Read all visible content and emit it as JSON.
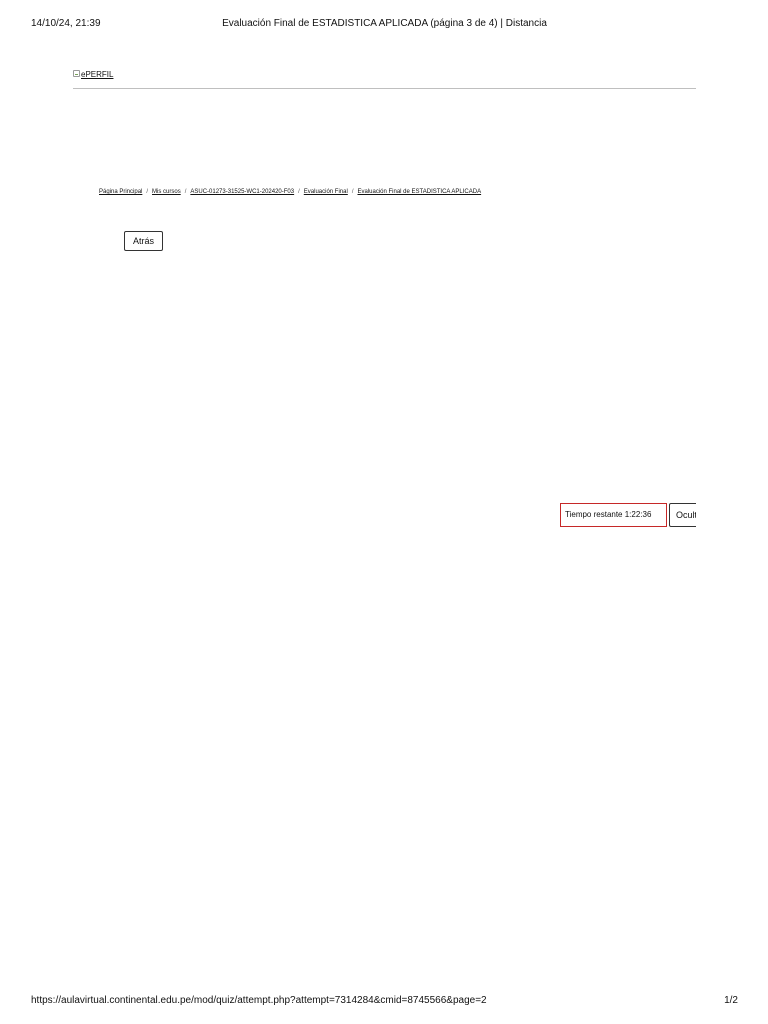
{
  "print_header": {
    "date": "14/10/24, 21:39",
    "title": "Evaluación Final de ESTADISTICA APLICADA (página 3 de 4) | Distancia"
  },
  "logo": {
    "alt_text": "ePERFIL",
    "icon": "broken-image-icon"
  },
  "breadcrumb": {
    "items": [
      "Página Principal",
      "Mis cursos",
      "ASUC-01273-31525-WC1-202420-F03",
      "Evaluación Final",
      "Evaluación Final de ESTADISTICA APLICADA"
    ],
    "separator": "/"
  },
  "back_button": {
    "label": "Atrás"
  },
  "timer": {
    "label": "Tiempo restante",
    "value": "1:22:36",
    "text": "Tiempo restante 1:22:36",
    "border_color": "#c62828"
  },
  "hide_button": {
    "label": "Ocultar"
  },
  "print_footer": {
    "url": "https://aulavirtual.continental.edu.pe/mod/quiz/attempt.php?attempt=7314284&cmid=8745566&page=2",
    "page": "1/2"
  }
}
